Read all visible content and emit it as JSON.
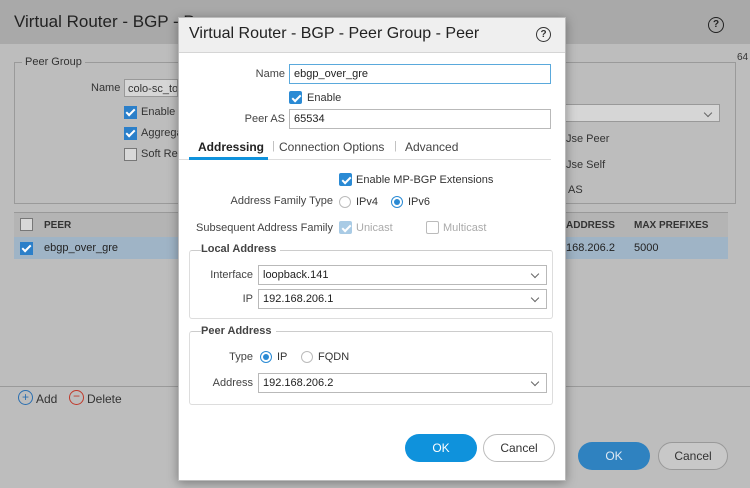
{
  "background": {
    "title": "Virtual Router - BGP - P",
    "help_glyph": "?",
    "peer_group_legend": "Peer Group",
    "name_label": "Name",
    "name_value": "colo-sc_to_",
    "enable_label": "Enable",
    "aggregate_label": "Aggrega",
    "soft_reset_label": "Soft Re",
    "right_text_1": "64",
    "right_text_2": "Jse Peer",
    "right_text_3": "Jse Self",
    "right_text_4": "AS",
    "table": {
      "col_peer": "PEER",
      "col_address": "ADDRESS",
      "col_max_prefixes": "MAX PREFIXES",
      "row": {
        "peer": "ebgp_over_gre",
        "address": "168.206.2",
        "max_prefixes": "5000"
      }
    },
    "add_label": "Add",
    "delete_label": "Delete",
    "ok_label": "OK",
    "cancel_label": "Cancel"
  },
  "modal": {
    "title": "Virtual Router - BGP - Peer Group - Peer",
    "help_glyph": "?",
    "name_label": "Name",
    "name_value": "ebgp_over_gre",
    "enable_label": "Enable",
    "peer_as_label": "Peer AS",
    "peer_as_value": "65534",
    "tabs": [
      {
        "label": "Addressing",
        "active": true
      },
      {
        "label": "Connection Options",
        "active": false
      },
      {
        "label": "Advanced",
        "active": false
      }
    ],
    "mp_bgp_label": "Enable MP-BGP Extensions",
    "address_family_type_label": "Address Family Type",
    "ipv4_label": "IPv4",
    "ipv6_label": "IPv6",
    "subsequent_af_label": "Subsequent Address Family",
    "unicast_label": "Unicast",
    "multicast_label": "Multicast",
    "local_address": {
      "legend": "Local Address",
      "interface_label": "Interface",
      "interface_value": "loopback.141",
      "ip_label": "IP",
      "ip_value": "192.168.206.1"
    },
    "peer_address": {
      "legend": "Peer Address",
      "type_label": "Type",
      "ip_option": "IP",
      "fqdn_option": "FQDN",
      "address_label": "Address",
      "address_value": "192.168.206.2"
    },
    "ok_label": "OK",
    "cancel_label": "Cancel"
  },
  "colors": {
    "accent": "#0f92dc",
    "check": "#2a8ad4"
  }
}
